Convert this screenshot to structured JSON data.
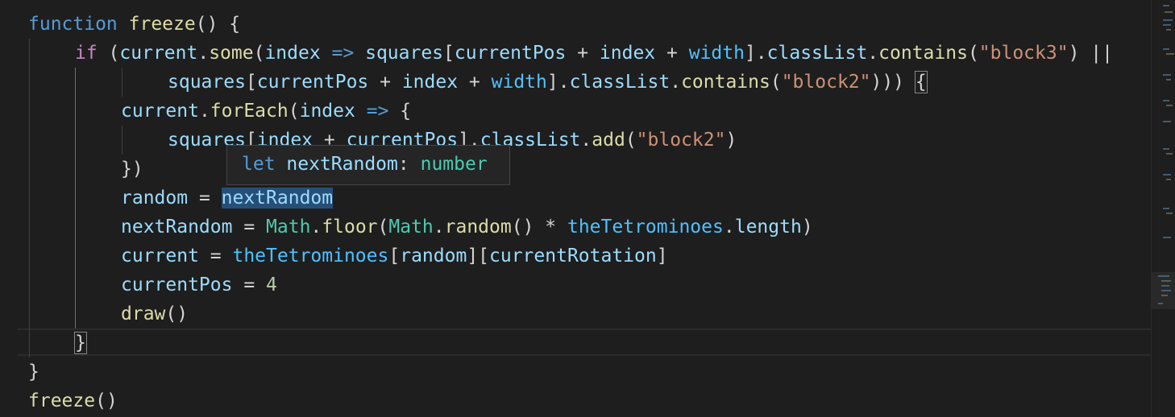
{
  "code": {
    "l1": {
      "kw": "function",
      "sp": " ",
      "fn": "freeze",
      "rest": "() {"
    },
    "l2": {
      "ctl": "if",
      "p1": " (",
      "v1": "current",
      "d1": ".",
      "f1": "some",
      "p2": "(",
      "v2": "index",
      "op": " => ",
      "v3": "squares",
      "p3": "[",
      "v4": "currentPos",
      "p4": " + ",
      "v5": "index",
      "p5": " + ",
      "v6": "width",
      "p6": "].",
      "v7": "classList",
      "d2": ".",
      "f2": "contains",
      "p7": "(",
      "s1": "\"block3\"",
      "p8": ") ||"
    },
    "l3": {
      "v1": "squares",
      "p1": "[",
      "v2": "currentPos",
      "p2": " + ",
      "v3": "index",
      "p3": " + ",
      "v4": "width",
      "p4": "].",
      "v5": "classList",
      "d1": ".",
      "f1": "contains",
      "p5": "(",
      "s1": "\"block2\"",
      "p6": "))) ",
      "brace": "{"
    },
    "l4": {
      "v1": "current",
      "d1": ".",
      "f1": "forEach",
      "p1": "(",
      "v2": "index",
      "op": " => ",
      "p2": "{"
    },
    "l5": {
      "v1": "squares",
      "p1": "[",
      "v2": "index",
      "p2": " + ",
      "v3": "currentPos",
      "p3": "].",
      "v4": "classList",
      "d1": ".",
      "f1": "add",
      "p4": "(",
      "s1": "\"block2\"",
      "p5": ")"
    },
    "l6": {
      "text": "})"
    },
    "l7": {
      "v1": "random",
      "op": " = ",
      "v2": "nextRandom"
    },
    "l8": {
      "v1": "nextRandom",
      "op": " = ",
      "c1": "Math",
      "d1": ".",
      "f1": "floor",
      "p1": "(",
      "c2": "Math",
      "d2": ".",
      "f2": "random",
      "p2": "() * ",
      "c3": "theTetrominoes",
      "d3": ".",
      "v2": "length",
      "p3": ")"
    },
    "l9": {
      "v1": "current",
      "op": " = ",
      "c1": "theTetrominoes",
      "p1": "[",
      "v2": "random",
      "p2": "][",
      "v3": "currentRotation",
      "p3": "]"
    },
    "l10": {
      "v1": "currentPos",
      "op": " = ",
      "n1": "4"
    },
    "l11": {
      "f1": "draw",
      "p1": "()"
    },
    "l12": {
      "brace": "}"
    },
    "l13": {
      "text": "}"
    },
    "l14": {
      "f1": "freeze",
      "p1": "()"
    }
  },
  "tooltip": {
    "kw": "let",
    "name": "nextRandom",
    "colon": ":",
    "type": "number"
  }
}
